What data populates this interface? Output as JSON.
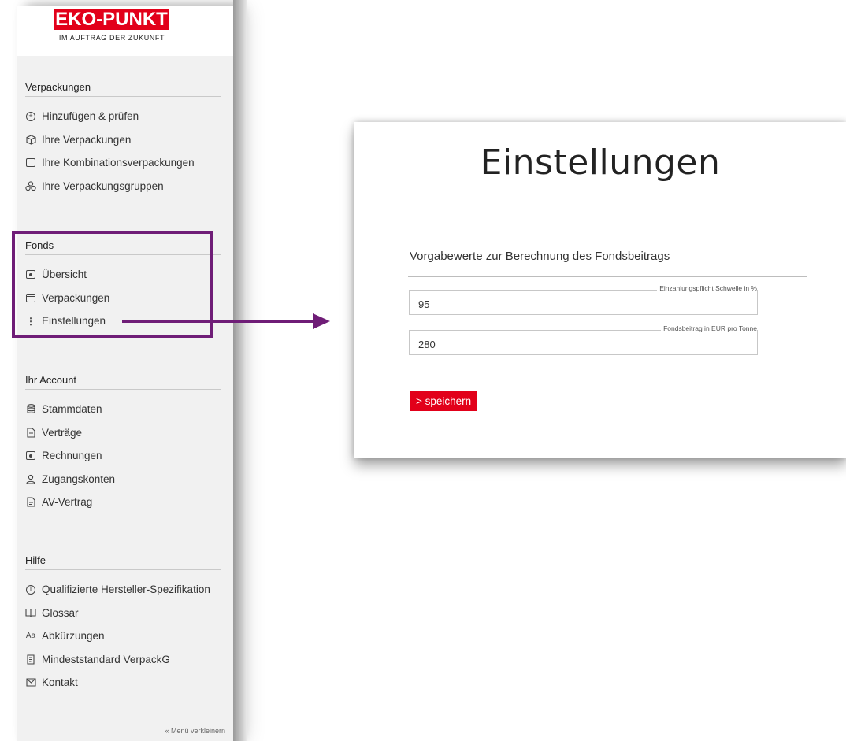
{
  "brand": {
    "logo_text": "EKO-PUNKT",
    "tagline": "IM AUFTRAG DER ZUKUNFT",
    "color": "#e2001a"
  },
  "sidebar": {
    "sections": [
      {
        "title": "Verpackungen",
        "items": [
          {
            "label": "Hinzufügen & prüfen",
            "icon": "plus-circle-icon"
          },
          {
            "label": "Ihre Verpackungen",
            "icon": "box-icon"
          },
          {
            "label": "Ihre Kombinationsverpackungen",
            "icon": "package-icon"
          },
          {
            "label": "Ihre Verpackungsgruppen",
            "icon": "group-icon"
          }
        ]
      },
      {
        "title": "Fonds",
        "items": [
          {
            "label": "Übersicht",
            "icon": "overview-icon"
          },
          {
            "label": "Verpackungen",
            "icon": "package-icon"
          },
          {
            "label": "Einstellungen",
            "icon": "more-vertical-icon"
          }
        ]
      },
      {
        "title": "Ihr Account",
        "items": [
          {
            "label": "Stammdaten",
            "icon": "database-icon"
          },
          {
            "label": "Verträge",
            "icon": "document-icon"
          },
          {
            "label": "Rechnungen",
            "icon": "invoice-icon"
          },
          {
            "label": "Zugangskonten",
            "icon": "user-icon"
          },
          {
            "label": "AV-Vertrag",
            "icon": "document-icon"
          }
        ]
      },
      {
        "title": "Hilfe",
        "items": [
          {
            "label": "Qualifizierte Hersteller-Spezifikation",
            "icon": "info-icon"
          },
          {
            "label": "Glossar",
            "icon": "book-icon"
          },
          {
            "label": "Abkürzungen",
            "icon": "abbreviation-icon"
          },
          {
            "label": "Mindeststandard VerpackG",
            "icon": "standard-icon"
          },
          {
            "label": "Kontakt",
            "icon": "mail-icon"
          }
        ]
      }
    ],
    "collapse_label": "« Menü verkleinern"
  },
  "highlight": {
    "color": "#6f1d77"
  },
  "settings": {
    "title": "Einstellungen",
    "subheading": "Vorgabewerte zur Berechnung des Fondsbeitrags",
    "fields": [
      {
        "label": "Einzahlungspflicht Schwelle in %",
        "value": "95"
      },
      {
        "label": "Fondsbeitrag in EUR pro Tonne",
        "value": "280"
      }
    ],
    "save_label": "> speichern"
  }
}
